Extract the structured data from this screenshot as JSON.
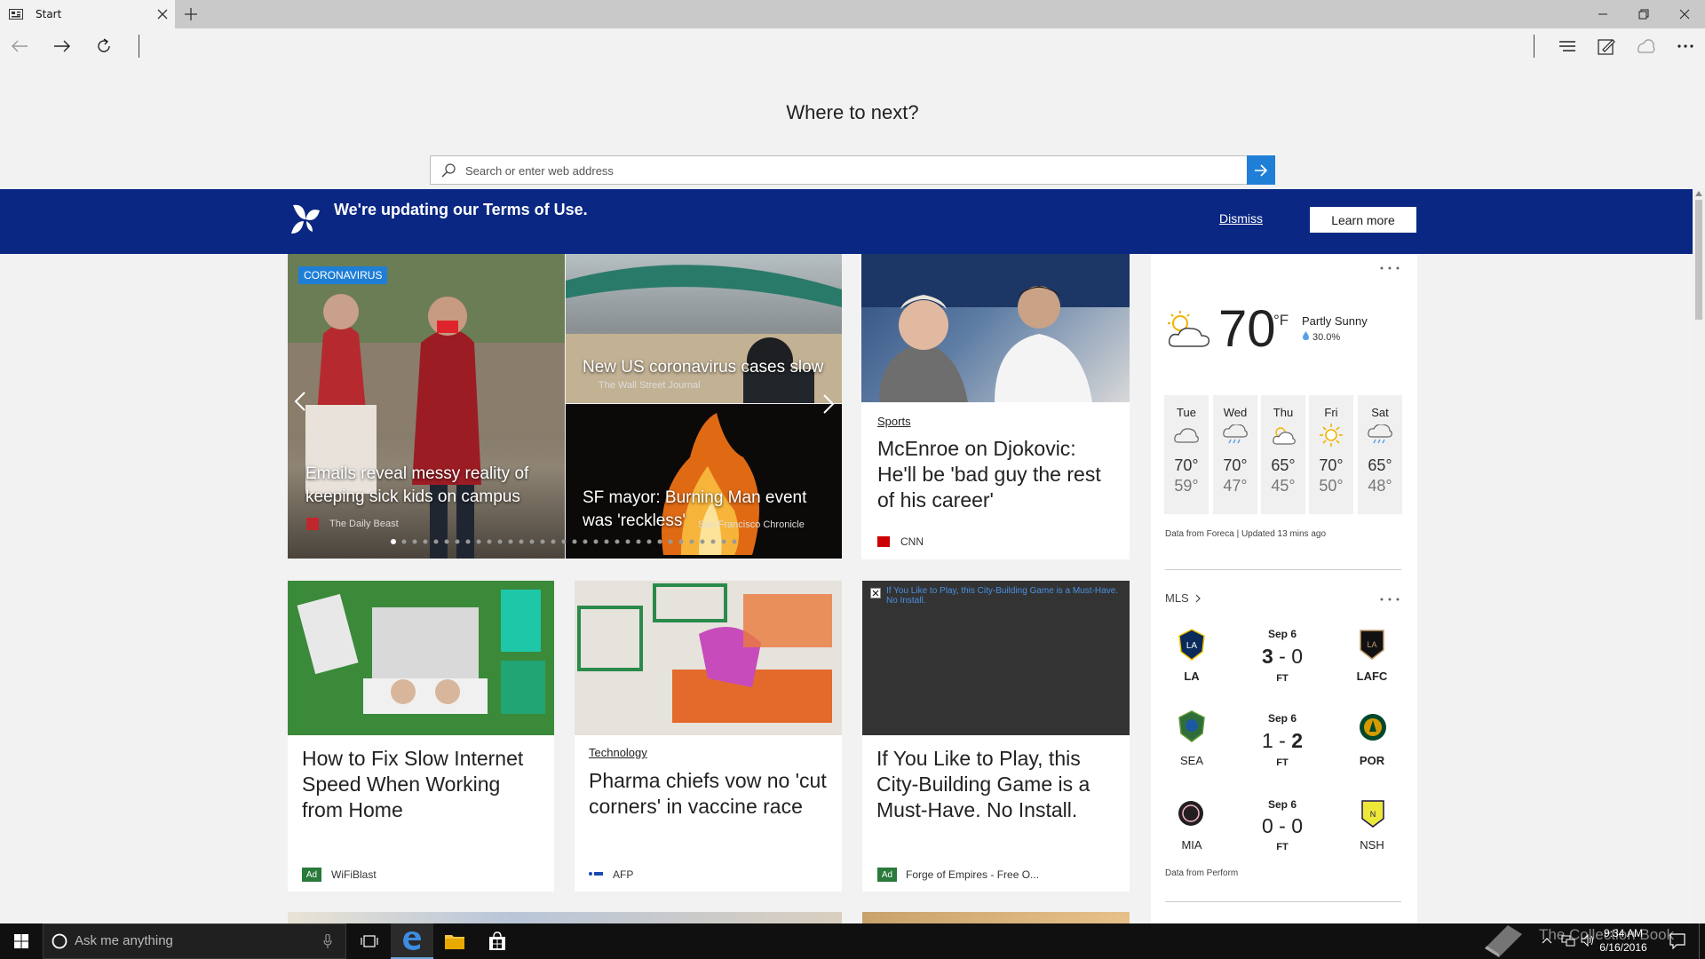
{
  "browser": {
    "tab_title": "Start",
    "heading": "Where to next?",
    "search_placeholder": "Search or enter web address"
  },
  "banner": {
    "text": "We're updating our Terms of Use.",
    "dismiss": "Dismiss",
    "learn_more": "Learn more"
  },
  "hero": {
    "tag": "CORONAVIRUS",
    "main_title": "Emails reveal messy reality of keeping sick kids on campus",
    "main_source": "The Daily Beast",
    "top_title": "New US coronavirus cases slow",
    "top_source": "The Wall Street Journal",
    "bottom_title": "SF mayor: Burning Man event was 'reckless'",
    "bottom_source": "San Francisco Chronicle"
  },
  "sports_card": {
    "category": "Sports",
    "title": "McEnroe on Djokovic: He'll be 'bad guy the rest of his career'",
    "source": "CNN"
  },
  "cards": [
    {
      "title": "How to Fix Slow Internet Speed When Working from Home",
      "source": "WiFiBlast",
      "ad": "Ad"
    },
    {
      "category": "Technology",
      "title": "Pharma chiefs vow no 'cut corners' in vaccine race",
      "source": "AFP"
    },
    {
      "ad_overlay": "If You Like to Play, this City-Building Game is a Must-Have. No Install.",
      "title": "If You Like to Play, this City-Building Game is a Must-Have. No Install.",
      "source": "Forge of Empires - Free O...",
      "ad": "Ad"
    }
  ],
  "weather": {
    "temp": "70",
    "unit": "°F",
    "condition": "Partly Sunny",
    "precip": "30.0%",
    "days": [
      {
        "day": "Tue",
        "hi": "70°",
        "lo": "59°",
        "icon": "cloudy-icon"
      },
      {
        "day": "Wed",
        "hi": "70°",
        "lo": "47°",
        "icon": "rain-icon"
      },
      {
        "day": "Thu",
        "hi": "65°",
        "lo": "45°",
        "icon": "partly-sunny-icon"
      },
      {
        "day": "Fri",
        "hi": "70°",
        "lo": "50°",
        "icon": "sunny-icon"
      },
      {
        "day": "Sat",
        "hi": "65°",
        "lo": "48°",
        "icon": "rain-icon"
      }
    ],
    "footer": "Data from Foreca | Updated 13 mins ago"
  },
  "mls": {
    "title": "MLS",
    "matches": [
      {
        "date": "Sep 6",
        "home": "LA",
        "away": "LAFC",
        "home_score": "3",
        "away_score": "0",
        "status": "FT"
      },
      {
        "date": "Sep 6",
        "home": "SEA",
        "away": "POR",
        "home_score": "1",
        "away_score": "2",
        "status": "FT"
      },
      {
        "date": "Sep 6",
        "home": "MIA",
        "away": "NSH",
        "home_score": "0",
        "away_score": "0",
        "status": "FT"
      }
    ],
    "footer": "Data from Perform"
  },
  "taskbar": {
    "search_placeholder": "Ask me anything",
    "time": "9:34 AM",
    "date": "6/16/2016",
    "watermark": "The Collection Book"
  }
}
